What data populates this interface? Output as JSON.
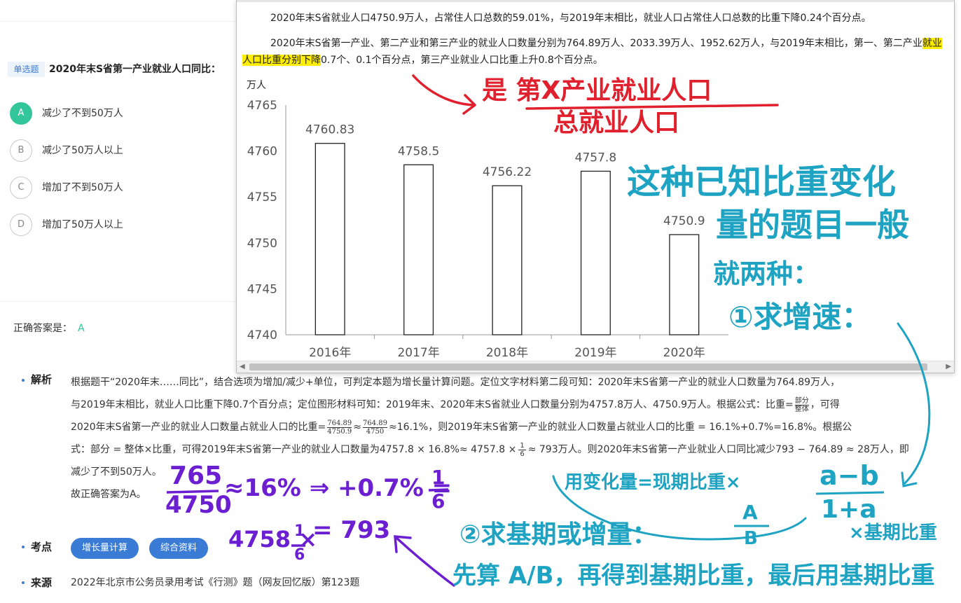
{
  "question": {
    "type_badge": "单选题",
    "stem": "2020年末S省第一产业就业人口同比：",
    "options": [
      {
        "letter": "A",
        "text": "减少了不到50万人",
        "selected": true
      },
      {
        "letter": "B",
        "text": "减少了50万人以上",
        "selected": false
      },
      {
        "letter": "C",
        "text": "增加了不到50万人",
        "selected": false
      },
      {
        "letter": "D",
        "text": "增加了50万人以上",
        "selected": false
      }
    ],
    "answer_label": "正确答案是：",
    "answer_value": "A"
  },
  "material": {
    "para1": "2020年末S省就业人口4750.9万人，占常住人口总数的59.01%，与2019年末相比，就业人口占常住人口总数的比重下降0.24个百分点。",
    "para2_before": "2020年末S省第一产业、第二产业和第三产业的就业人口数量分别为764.89万人、2033.39万人、1952.62万人，与2019年末相比，第一、第二产业",
    "para2_highlight": "就业人口比重分别下降",
    "para2_after": "0.7个、0.1个百分点，第三产业就业人口比重上升0.8个百分点。"
  },
  "chart_data": {
    "type": "bar",
    "ylabel": "万人",
    "categories": [
      "2016年",
      "2017年",
      "2018年",
      "2019年",
      "2020年"
    ],
    "values": [
      4760.83,
      4758.5,
      4756.22,
      4757.8,
      4750.9
    ],
    "value_labels": [
      "4760.83",
      "4758.5",
      "4756.22",
      "4757.8",
      "4750.9"
    ],
    "yticks": [
      "4740",
      "4745",
      "4750",
      "4755",
      "4760",
      "4765"
    ],
    "ylim": [
      4740,
      4765
    ],
    "grid": false,
    "bar_color": "#ffffff",
    "bar_stroke": "#222222"
  },
  "analysis": {
    "label": "解析",
    "line1": "根据题干“2020年末……同比”，结合选项为增加/减少+单位，可判定本题为增长量计算问题。定位文字材料第二段可知：2020年末S省第一产业的就业人口数量为764.89万人，",
    "line2": "与2019年末相比，就业人口比重下降0.7个百分点；定位图形材料可知：2019年末、2020年末S省就业人口数量分别为4757.8万人、4750.9万人。根据公式：比重=",
    "frac1_num": "部分",
    "frac1_den": "整体",
    "line2_end": "，可得",
    "line3_a": "2020年末S省第一产业的就业人口数量占就业人口的比重=",
    "f2_num": "764.89",
    "f2_den": "4750.9",
    "approx": "≈",
    "f3_num": "764.89",
    "f3_den": "4750",
    "line3_b": "≈16.1%，则2019年末S省第一产业的就业人口数量占就业人口的比重 = 16.1%+0.7%=16.8%。根据公",
    "line4_a": "式：部分 = 整体×比重，可得2019年末S省第一产业的就业人口数量为4757.8 × 16.8%≈ 4757.8 ×",
    "f4_num": "1",
    "f4_den": "6",
    "line4_b": "≈ 793万人。则2020年末S省第一产业就业人口同比减少793 − 764.89 ≈ 28万人，即",
    "line5": "减少了不到50万人。",
    "line6": "故正确答案为A。"
  },
  "kaodian": {
    "label": "考点",
    "tags": [
      "增长量计算",
      "综合资料"
    ]
  },
  "source": {
    "label": "来源",
    "text": "2022年北京市公务员录用考试《行测》题（网友回忆版）第123题"
  },
  "handwriting": {
    "red_line1": "是 第X产业就业人口",
    "red_line2": "总就业人口",
    "cyan_line1": "这种已知比重变化",
    "cyan_line2": "量的题目一般",
    "cyan_line3": "就两种：",
    "cyan_line4": "①求增速：",
    "cyan_formula_pre": "用变化量=现期比重×",
    "cyan_formula_num": "a−b",
    "cyan_formula_den": "1+a",
    "cyan_ab_num": "A",
    "cyan_ab_den": "B",
    "cyan_line5": "②求基期或增量：",
    "cyan_base": "×基期比重",
    "cyan_line6": "先算 A/B，再得到基期比重，最后用基期比重",
    "purple_frac_num": "765",
    "purple_frac_den": "4750",
    "purple_line1_rest": "≈16% ⇒ +0.7% =",
    "purple_one": "1",
    "purple_six": "6",
    "purple_line2": "4758 ×",
    "purple_line2_end": "= 793"
  }
}
